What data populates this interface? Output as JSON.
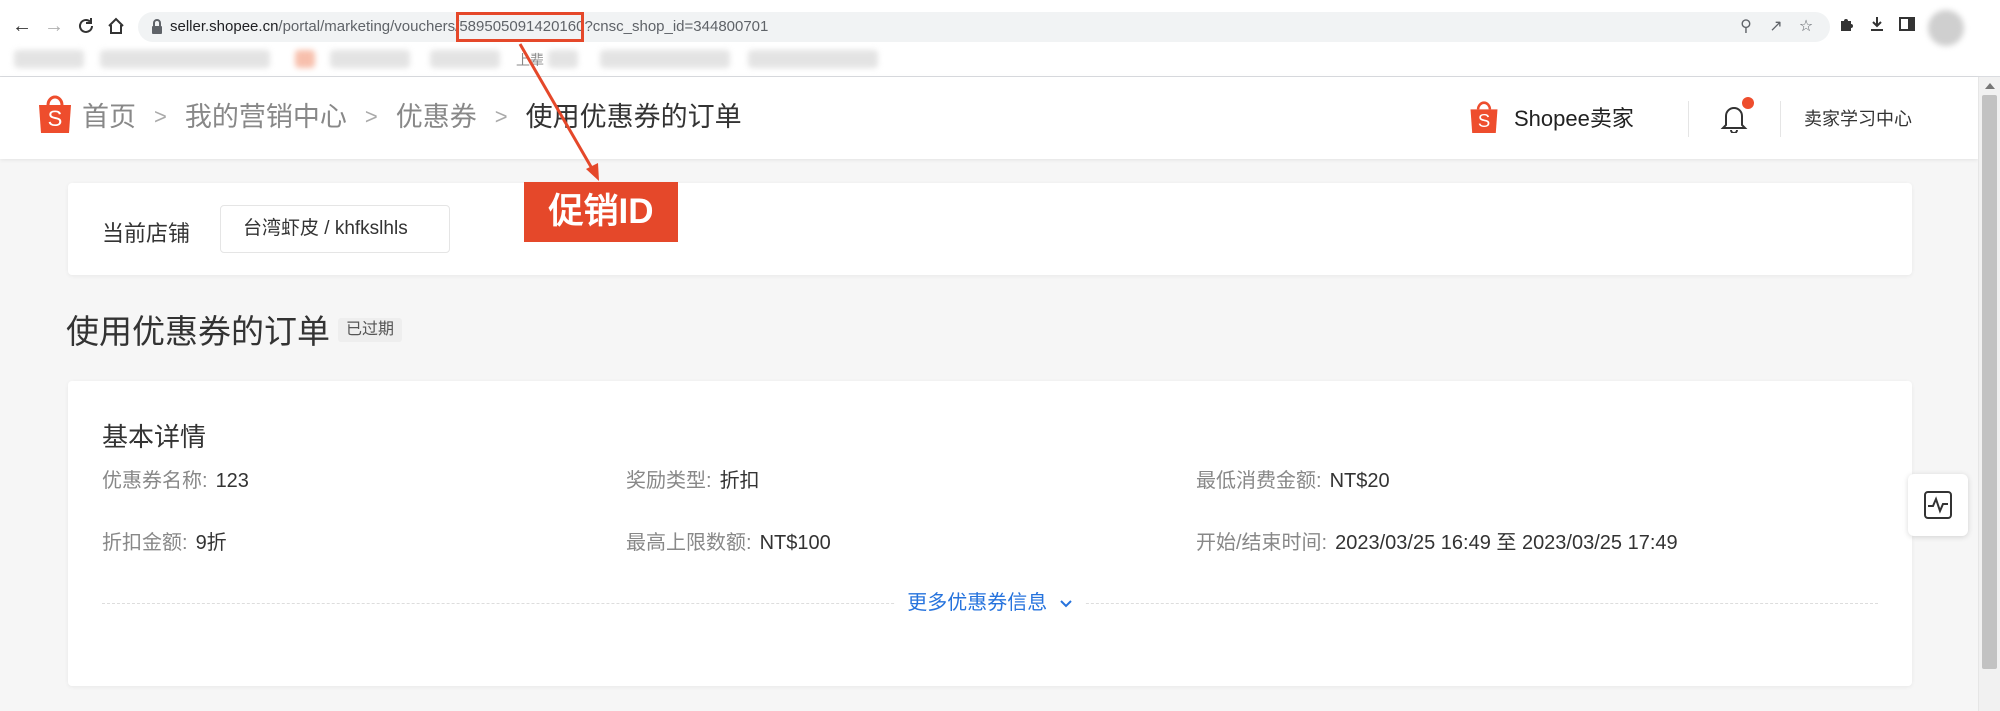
{
  "browser": {
    "url_host": "seller.shopee.cn",
    "url_path": "/portal/marketing/vouchers/589505091420160?cnsc_shop_id=344800701",
    "bookmark_fragment": "上辈"
  },
  "header": {
    "breadcrumb": [
      "首页",
      "我的营销中心",
      "优惠券",
      "使用优惠券的订单"
    ],
    "seller_logo_text": "Shopee卖家",
    "learn_center": "卖家学习中心"
  },
  "shop": {
    "label": "当前店铺",
    "value": "台湾虾皮 / khfkslhls"
  },
  "page": {
    "title": "使用优惠券的订单",
    "status": "已过期"
  },
  "details": {
    "title": "基本详情",
    "fields": [
      {
        "key": "优惠券名称:",
        "value": "123"
      },
      {
        "key": "奖励类型:",
        "value": "折扣"
      },
      {
        "key": "最低消费金额:",
        "value": "NT$20"
      },
      {
        "key": "折扣金额:",
        "value": "9折"
      },
      {
        "key": "最高上限数额:",
        "value": "NT$100"
      },
      {
        "key": "开始/结束时间:",
        "value": "2023/03/25 16:49 至 2023/03/25 17:49"
      }
    ],
    "more_link": "更多优惠券信息"
  },
  "annotation": {
    "label": "促销ID",
    "color": "#e5482a"
  },
  "colors": {
    "brand": "#ee4d2d",
    "link": "#2673dd"
  },
  "icons": [
    "back-arrow-icon",
    "forward-arrow-icon",
    "reload-icon",
    "home-icon",
    "lock-icon",
    "zoom-icon",
    "share-icon",
    "star-icon",
    "puzzle-icon",
    "download-icon",
    "sidebar-icon",
    "shopee-bag-icon",
    "bell-icon",
    "chevron-down-icon",
    "pulse-chart-icon"
  ]
}
